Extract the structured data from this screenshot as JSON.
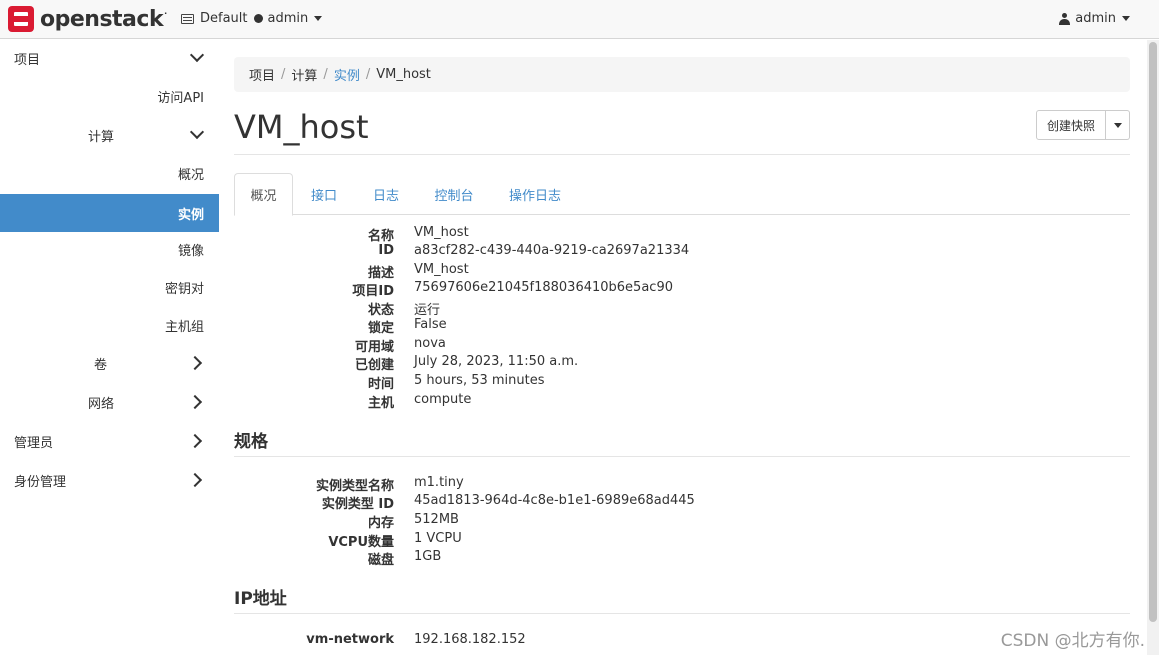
{
  "brand": {
    "logo_text": "openstack",
    "tm": "."
  },
  "navbar": {
    "domain": "Default",
    "project": "admin",
    "user": "admin"
  },
  "sidebar": {
    "items": [
      {
        "label": "项目",
        "chevron": "down"
      },
      {
        "label": "访问API"
      },
      {
        "label": "计算",
        "chevron": "down"
      },
      {
        "label": "概况"
      },
      {
        "label": "实例",
        "active": true
      },
      {
        "label": "镜像"
      },
      {
        "label": "密钥对"
      },
      {
        "label": "主机组"
      },
      {
        "label": "卷",
        "chevron": "right"
      },
      {
        "label": "网络",
        "chevron": "right"
      },
      {
        "label": "管理员",
        "chevron": "right"
      },
      {
        "label": "身份管理",
        "chevron": "right"
      }
    ]
  },
  "breadcrumb": {
    "items": [
      "项目",
      "计算",
      "实例",
      "VM_host"
    ]
  },
  "page": {
    "title": "VM_host",
    "snapshot_button": "创建快照"
  },
  "tabs": [
    "概况",
    "接口",
    "日志",
    "控制台",
    "操作日志"
  ],
  "overview": [
    {
      "label": "名称",
      "value": "VM_host"
    },
    {
      "label": "ID",
      "value": "a83cf282-c439-440a-9219-ca2697a21334"
    },
    {
      "label": "描述",
      "value": "VM_host"
    },
    {
      "label": "项目ID",
      "value": "75697606e21045f188036410b6e5ac90"
    },
    {
      "label": "状态",
      "value": "运行"
    },
    {
      "label": "锁定",
      "value": "False"
    },
    {
      "label": "可用域",
      "value": "nova"
    },
    {
      "label": "已创建",
      "value": "July 28, 2023, 11:50 a.m."
    },
    {
      "label": "时间",
      "value": "5 hours, 53 minutes"
    },
    {
      "label": "主机",
      "value": "compute"
    }
  ],
  "flavor": {
    "heading": "规格",
    "rows": [
      {
        "label": "实例类型名称",
        "value": "m1.tiny"
      },
      {
        "label": "实例类型 ID",
        "value": "45ad1813-964d-4c8e-b1e1-6989e68ad445"
      },
      {
        "label": "内存",
        "value": "512MB"
      },
      {
        "label": "VCPU数量",
        "value": "1 VCPU"
      },
      {
        "label": "磁盘",
        "value": "1GB"
      }
    ]
  },
  "ip": {
    "heading": "IP地址",
    "rows": [
      {
        "label": "vm-network",
        "value": "192.168.182.152"
      }
    ]
  },
  "watermark": "CSDN @北方有你."
}
